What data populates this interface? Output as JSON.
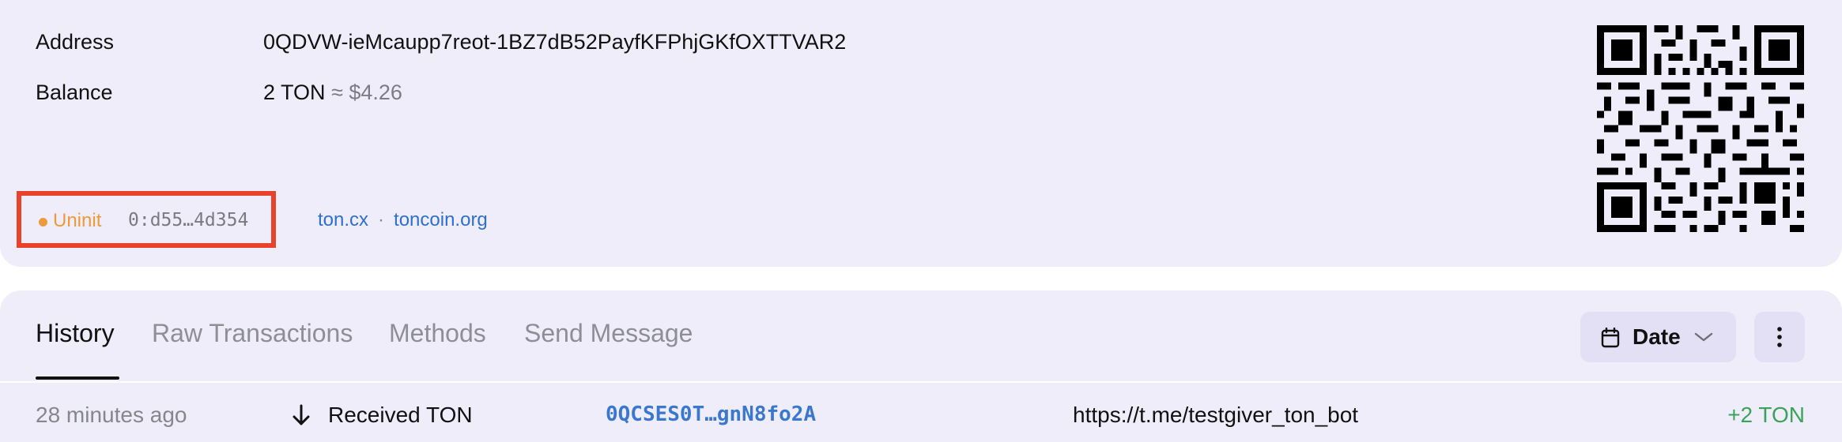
{
  "account": {
    "address_label": "Address",
    "address_value": "0QDVW-ieMcaupp7reot-1BZ7dB52PayfKFPhjGKfOXTTVAR2",
    "balance_label": "Balance",
    "balance_value": "2 TON",
    "balance_fiat": "≈ $4.26",
    "status": "Uninit",
    "status_color": "#ee9a3a",
    "raw_address": "0:d55…4d354",
    "links": [
      "ton.cx",
      "toncoin.org"
    ],
    "link_separator": "·"
  },
  "tabs": {
    "items": [
      "History",
      "Raw Transactions",
      "Methods",
      "Send Message"
    ],
    "active": "History"
  },
  "controls": {
    "date_label": "Date",
    "date_icon": "calendar-icon",
    "more_icon": "more-vertical-icon"
  },
  "transactions": [
    {
      "time": "28 minutes ago",
      "type": "Received TON",
      "direction_icon": "arrow-down-icon",
      "address": "0QCSES0T…gnN8fo2A",
      "comment": "https://t.me/testgiver_ton_bot",
      "amount": "+2 TON",
      "amount_color": "#3aa35a"
    }
  ]
}
